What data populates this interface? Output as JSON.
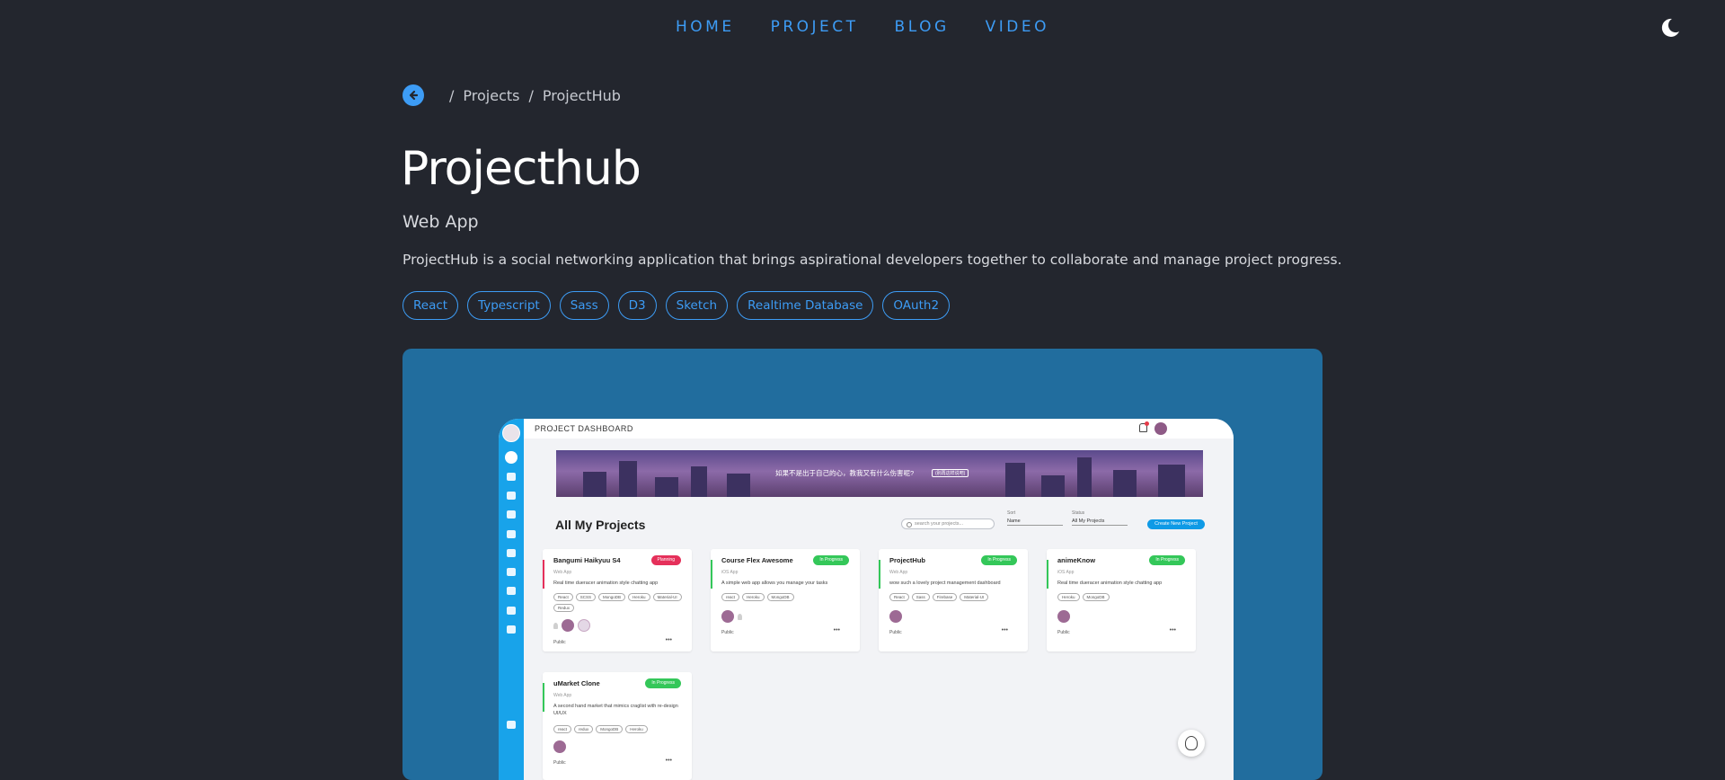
{
  "nav": {
    "links": [
      "HOME",
      "PROJECT",
      "BLOG",
      "VIDEO"
    ],
    "theme_icon": "moon-icon",
    "link_color": "#3d9cf5"
  },
  "breadcrumb": {
    "back_icon": "arrow-left-icon",
    "separator": "/",
    "items": [
      "Projects",
      "ProjectHub"
    ]
  },
  "project": {
    "title": "Projecthub",
    "category": "Web App",
    "description": "ProjectHub is a social networking application that brings aspirational developers together to collaborate and manage project progress.",
    "tags": [
      "React",
      "Typescript",
      "Sass",
      "D3",
      "Sketch",
      "Realtime Database",
      "OAuth2"
    ]
  },
  "colors": {
    "background": "#23262e",
    "accent": "#3d9cf5",
    "preview_bg": "#216d9e",
    "app_sidebar": "#18a3ea"
  },
  "screenshot": {
    "app_title": "PROJECT DASHBOARD",
    "banner_text": "如果不是出于自己的心，教我又有什么伤害呢?",
    "banner_tag": "(别再这样说吧)",
    "section_title": "All My Projects",
    "search_placeholder": "search your projects...",
    "sort_label": "Sort",
    "sort_value": "Name",
    "status_label": "Status",
    "status_value": "All My Projects",
    "create_label": "Create New Project",
    "cards": [
      {
        "title": "Bangumi Haikyuu S4",
        "status": "Planning",
        "status_color": "#e5305a",
        "type": "Web App",
        "description": "Real time dueracer animation style chatting app",
        "chips": [
          "React",
          "SCSS",
          "MongoDB",
          "Heroku",
          "Material-UI",
          "Redux"
        ],
        "visibility": "Public"
      },
      {
        "title": "Course Flex Awesome",
        "status": "In Progress",
        "status_color": "#34c759",
        "type": "iOS App",
        "description": "A simple web app allows you manage your tasks",
        "chips": [
          "react",
          "Heroku",
          "MongoDB"
        ],
        "visibility": "Public"
      },
      {
        "title": "ProjectHub",
        "status": "In Progress",
        "status_color": "#34c759",
        "type": "Web App",
        "description": "wow such a lovely project management dashboard",
        "chips": [
          "React",
          "Sass",
          "Firebase",
          "Material-UI"
        ],
        "visibility": "Public"
      },
      {
        "title": "animeKnow",
        "status": "In Progress",
        "status_color": "#34c759",
        "type": "iOS App",
        "description": "Real time dueracer animation style chatting app",
        "chips": [
          "Heroku",
          "MongoDB"
        ],
        "visibility": "Public"
      },
      {
        "title": "uMarket Clone",
        "status": "In Progress",
        "status_color": "#34c759",
        "type": "Web App",
        "description": "A second hand market that mimics craglist with re-design UI/UX",
        "chips": [
          "react",
          "redux",
          "MongoDB",
          "Heroku"
        ],
        "visibility": "Public"
      }
    ],
    "more_label": "•••"
  }
}
